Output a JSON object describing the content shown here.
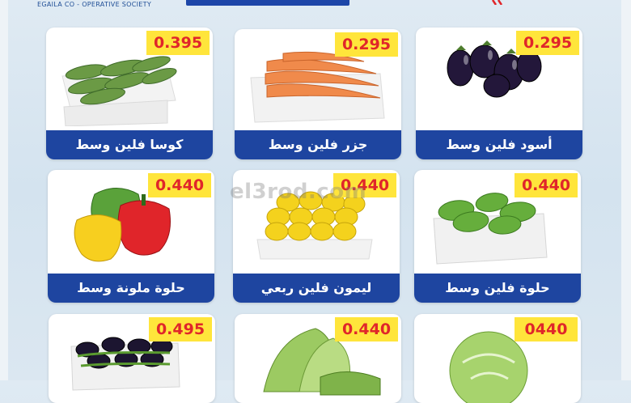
{
  "header": {
    "society_text": "EGAILA CO - OPERATIVE SOCIETY"
  },
  "watermark": "el3rod.com",
  "colors": {
    "label_bg": "#1e45a0",
    "price_bg": "#ffe53b",
    "price_text": "#e0262a"
  },
  "products": [
    {
      "name": "كوسا فلين وسط",
      "price": "0.395",
      "image": "zucchini-in-foam-tray"
    },
    {
      "name": "جزر فلين وسط",
      "price": "0.295",
      "image": "carrots-in-foam-tray"
    },
    {
      "name": "أسود فلين وسط",
      "price": "0.295",
      "image": "eggplants"
    },
    {
      "name": "حلوة ملونة وسط",
      "price": "0.440",
      "image": "colored-bell-peppers"
    },
    {
      "name": "ليمون فلين ربعي",
      "price": "0.440",
      "image": "lemons-in-foam-tray"
    },
    {
      "name": "حلوة فلين وسط",
      "price": "0.440",
      "image": "green-peppers-in-foam-tray"
    },
    {
      "name": "",
      "price": "0.495",
      "image": "black-eggplants-with-beans"
    },
    {
      "name": "",
      "price": "0.440",
      "image": "lettuce"
    },
    {
      "name": "",
      "price": "0440",
      "image": "cabbage"
    }
  ]
}
